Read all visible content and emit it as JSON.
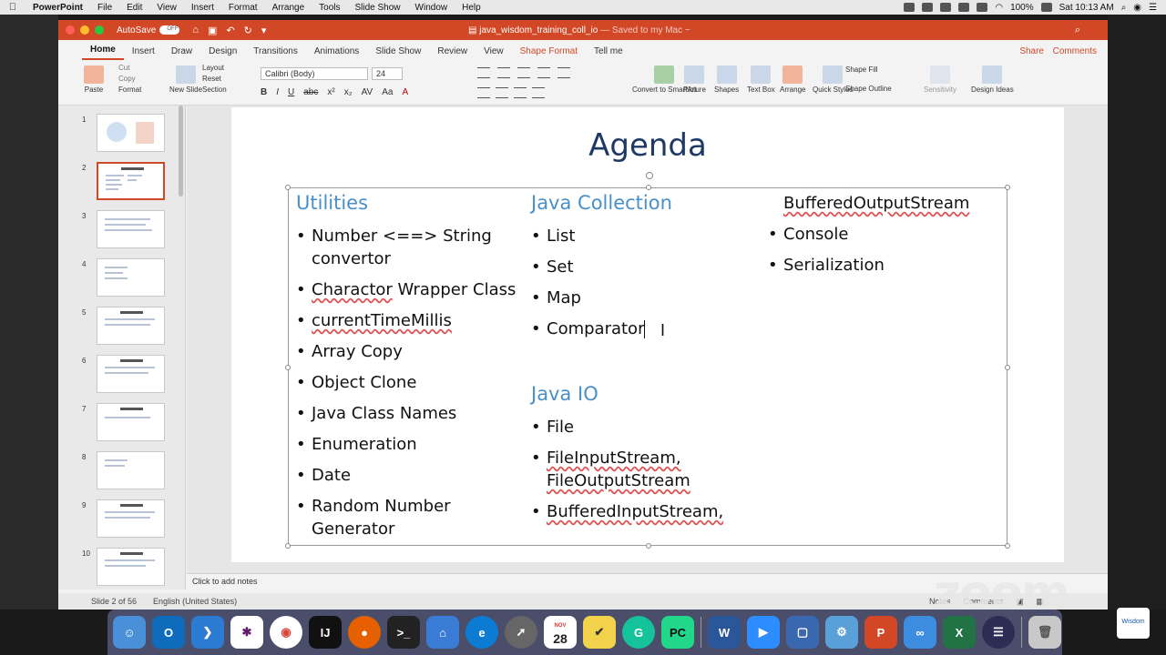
{
  "menubar": {
    "app_name": "PowerPoint",
    "items": [
      "File",
      "Edit",
      "View",
      "Insert",
      "Format",
      "Arrange",
      "Tools",
      "Slide Show",
      "Window",
      "Help"
    ],
    "battery": "100%",
    "clock": "Sat 10:13 AM"
  },
  "window": {
    "autosave_label": "AutoSave",
    "autosave_state": "OFF",
    "doc_title": "java_wisdom_training_coll_io",
    "saved_status": "— Saved to my Mac ~"
  },
  "ribbon_tabs": [
    "Home",
    "Insert",
    "Draw",
    "Design",
    "Transitions",
    "Animations",
    "Slide Show",
    "Review",
    "View",
    "Shape Format",
    "Tell me"
  ],
  "share_label": "Share",
  "comments_label": "Comments",
  "ribbon": {
    "paste": "Paste",
    "cut": "Cut",
    "copy": "Copy",
    "format": "Format",
    "new_slide": "New Slide",
    "layout": "Layout",
    "reset": "Reset",
    "section": "Section",
    "font_name": "Calibri (Body)",
    "font_size": "24",
    "format_buttons": [
      "B",
      "I",
      "U",
      "abc",
      "x²",
      "x₂",
      "AV",
      "Aa",
      "A"
    ],
    "convert_smartart": "Convert to SmartArt",
    "picture": "Picture",
    "shapes": "Shapes",
    "text_box": "Text Box",
    "arrange": "Arrange",
    "quick_styles": "Quick Styles",
    "shape_fill": "Shape Fill",
    "shape_outline": "Shape Outline",
    "sensitivity": "Sensitivity",
    "design_ideas": "Design Ideas"
  },
  "thumbnails": [
    {
      "num": "1"
    },
    {
      "num": "2"
    },
    {
      "num": "3"
    },
    {
      "num": "4"
    },
    {
      "num": "5"
    },
    {
      "num": "6"
    },
    {
      "num": "7"
    },
    {
      "num": "8"
    },
    {
      "num": "9"
    },
    {
      "num": "10"
    }
  ],
  "slide": {
    "title": "Agenda",
    "col1": {
      "heading": "Utilities",
      "items": [
        "Number <==> String convertor",
        "Charactor Wrapper Class",
        "currentTimeMillis",
        "Array Copy",
        "Object Clone",
        "Java Class Names",
        "Enumeration",
        "Date",
        "Random Number Generator"
      ]
    },
    "col2": {
      "heading": "Java Collection",
      "items": [
        "List",
        "Set",
        "Map",
        "Comparator"
      ],
      "heading2": "Java IO",
      "items2": [
        "File",
        "FileInputStream, FileOutputStream",
        "BufferedInputStream,"
      ]
    },
    "col3": {
      "continued": "BufferedOutputStream",
      "items": [
        "Console",
        "Serialization"
      ]
    }
  },
  "notes_placeholder": "Click to add notes",
  "status": {
    "slide_count": "Slide 2 of 56",
    "language": "English (United States)",
    "notes": "Notes",
    "comments": "Comments"
  },
  "watermark": "zoom",
  "dock": {
    "calendar_month": "NOV",
    "calendar_day": "28"
  },
  "corner_logo": "Wisdom"
}
